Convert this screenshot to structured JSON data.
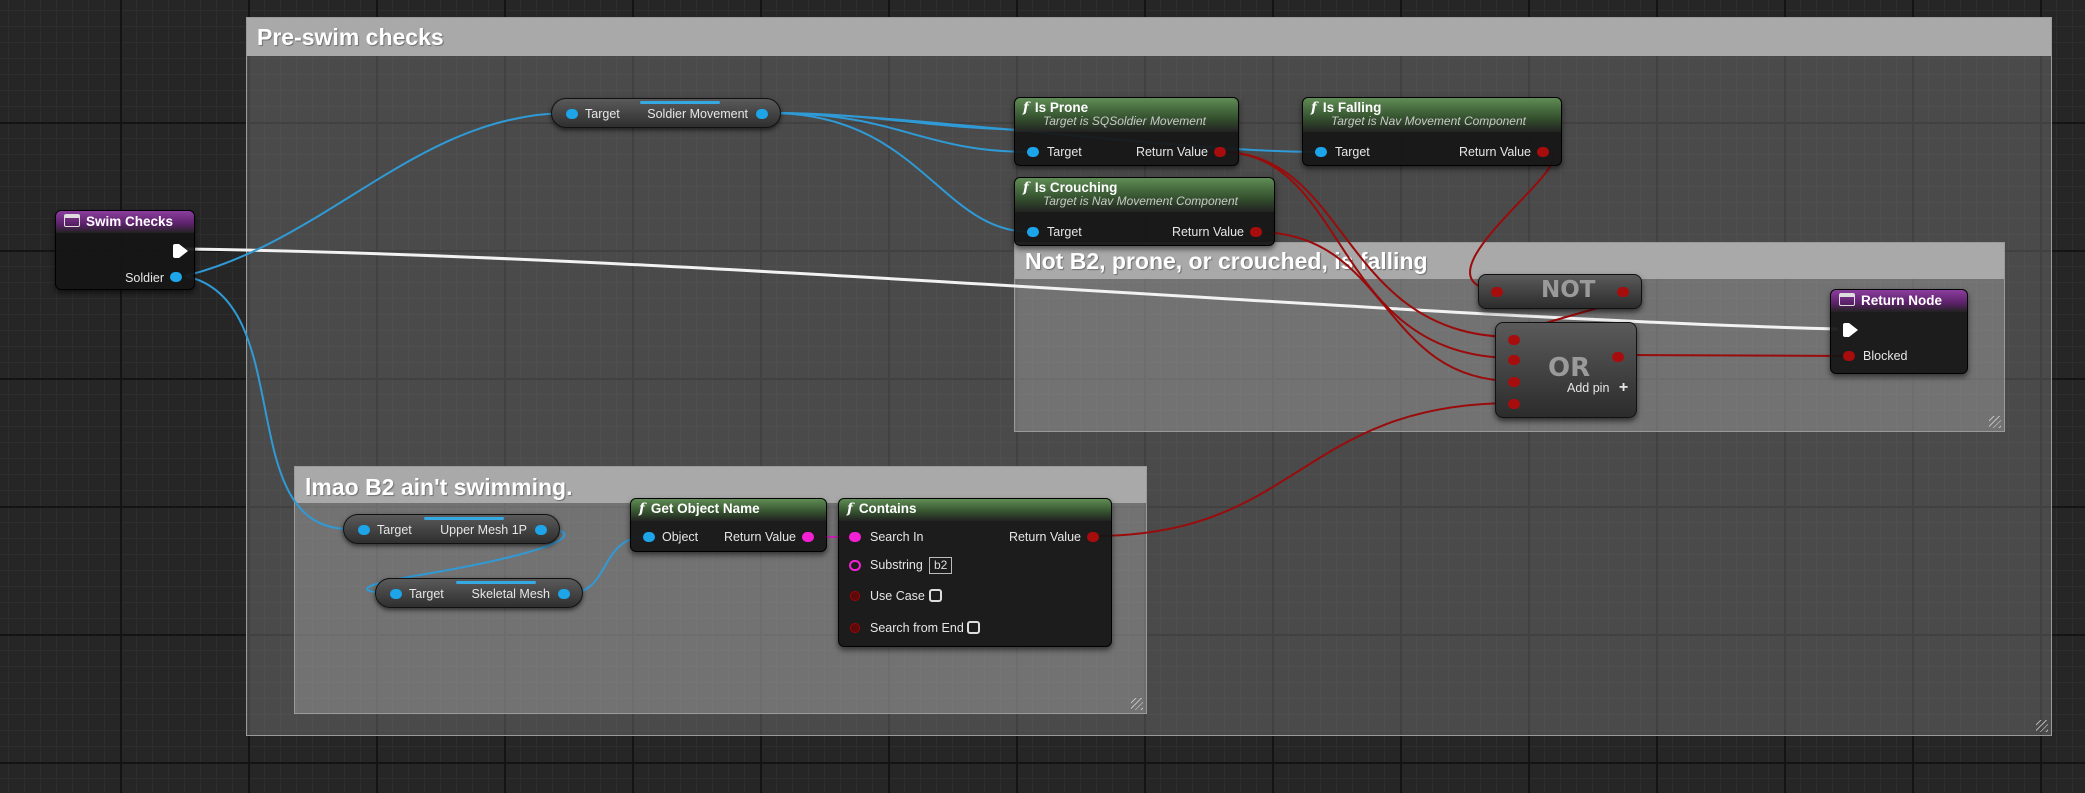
{
  "colors": {
    "data_object": "#1ea4e8",
    "boolean": "#a80d0d",
    "string": "#f321d3",
    "exec": "#ffffff",
    "function_header": "#4b7344",
    "event_header": "#7a2f8c"
  },
  "comments": {
    "pre_swim": "Pre-swim checks",
    "not_b2": "Not B2, prone, or crouched, is falling",
    "lmao": "lmao B2 ain't swimming."
  },
  "entry": {
    "title": "Swim Checks",
    "icon": "function-entry-icon",
    "param": "Soldier"
  },
  "soldier_movement": {
    "in": "Target",
    "out": "Soldier Movement"
  },
  "is_prone": {
    "title": "Is Prone",
    "subtitle": "Target is SQSoldier Movement",
    "in": "Target",
    "out": "Return Value"
  },
  "is_crouching": {
    "title": "Is Crouching",
    "subtitle": "Target is Nav Movement Component",
    "in": "Target",
    "out": "Return Value"
  },
  "is_falling": {
    "title": "Is Falling",
    "subtitle": "Target is Nav Movement Component",
    "in": "Target",
    "out": "Return Value"
  },
  "not_node": {
    "label": "NOT"
  },
  "or_node": {
    "label": "OR",
    "add_pin": "Add pin",
    "add_symbol": "+"
  },
  "return_node": {
    "title": "Return Node",
    "param": "Blocked"
  },
  "upper_mesh": {
    "in": "Target",
    "out": "Upper Mesh 1P"
  },
  "skeletal_mesh": {
    "in": "Target",
    "out": "Skeletal Mesh"
  },
  "get_object_name": {
    "title": "Get Object Name",
    "in": "Object",
    "out": "Return Value"
  },
  "contains": {
    "title": "Contains",
    "search_in": "Search In",
    "substring": "Substring",
    "substring_value": "b2",
    "use_case": "Use Case",
    "search_from_end": "Search from End",
    "out": "Return Value"
  }
}
